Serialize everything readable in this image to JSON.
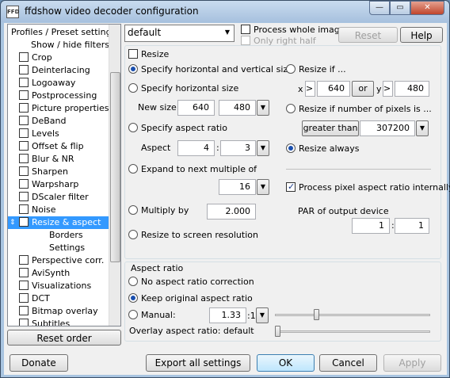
{
  "window": {
    "title": "ffdshow video decoder configuration",
    "icon_text": "FFD"
  },
  "titlebar_buttons": {
    "minimize": "—",
    "maximize": "▭",
    "close": "✕"
  },
  "tree": {
    "items": [
      {
        "label": "Profiles / Preset settings",
        "checkbox": false,
        "indent": 0
      },
      {
        "label": "Show / hide filters",
        "checkbox": false,
        "indent": 1
      },
      {
        "label": "Crop",
        "checkbox": true,
        "checked": false
      },
      {
        "label": "Deinterlacing",
        "checkbox": true,
        "checked": false
      },
      {
        "label": "Logoaway",
        "checkbox": true,
        "checked": false
      },
      {
        "label": "Postprocessing",
        "checkbox": true,
        "checked": false
      },
      {
        "label": "Picture properties",
        "checkbox": true,
        "checked": false
      },
      {
        "label": "DeBand",
        "checkbox": true,
        "checked": false
      },
      {
        "label": "Levels",
        "checkbox": true,
        "checked": false
      },
      {
        "label": "Offset & flip",
        "checkbox": true,
        "checked": false
      },
      {
        "label": "Blur & NR",
        "checkbox": true,
        "checked": false
      },
      {
        "label": "Sharpen",
        "checkbox": true,
        "checked": false
      },
      {
        "label": "Warpsharp",
        "checkbox": true,
        "checked": false
      },
      {
        "label": "DScaler filter",
        "checkbox": true,
        "checked": false
      },
      {
        "label": "Noise",
        "checkbox": true,
        "checked": false
      },
      {
        "label": "Resize & aspect",
        "checkbox": true,
        "checked": false,
        "selected": true
      },
      {
        "label": "Borders",
        "checkbox": false,
        "indent": 2
      },
      {
        "label": "Settings",
        "checkbox": false,
        "indent": 2
      },
      {
        "label": "Perspective corr.",
        "checkbox": true,
        "checked": false
      },
      {
        "label": "AviSynth",
        "checkbox": true,
        "checked": false
      },
      {
        "label": "Visualizations",
        "checkbox": true,
        "checked": false
      },
      {
        "label": "DCT",
        "checkbox": true,
        "checked": false
      },
      {
        "label": "Bitmap overlay",
        "checkbox": true,
        "checked": false
      },
      {
        "label": "Subtitles",
        "checkbox": true,
        "checked": false
      }
    ]
  },
  "buttons": {
    "reset_order": "Reset order",
    "reset": "Reset",
    "help": "Help",
    "donate": "Donate",
    "export_all": "Export all settings",
    "ok": "OK",
    "cancel": "Cancel",
    "apply": "Apply"
  },
  "profile": {
    "selected": "default"
  },
  "top_options": {
    "process_whole_image": "Process whole image",
    "only_right_half": "Only right half"
  },
  "resize": {
    "checkbox_label": "Resize",
    "specify_hv": "Specify horizontal and vertical size",
    "specify_h": "Specify horizontal size",
    "new_size_label": "New size",
    "new_w": "640",
    "new_h": "480",
    "specify_aspect": "Specify aspect ratio",
    "aspect_label": "Aspect",
    "aspect_a": "4",
    "aspect_b": "3",
    "expand_label": "Expand to next multiple of",
    "expand_value": "16",
    "multiply_label": "Multiply by",
    "multiply_value": "2.000",
    "screen_res": "Resize to screen resolution"
  },
  "resize_if": {
    "label": "Resize if ...",
    "x_label": "x",
    "x_op": ">",
    "x_value": "640",
    "or_label": "or",
    "y_label": "y",
    "y_op": ">",
    "y_value": "480",
    "pixels_label": "Resize if number of pixels is ...",
    "pixels_op": "greater than",
    "pixels_value": "307200",
    "always": "Resize always",
    "process_par": "Process pixel aspect ratio internally",
    "par_label": "PAR of output device",
    "par_a": "1",
    "par_b": "1"
  },
  "aspect_ratio": {
    "group_label": "Aspect ratio",
    "none": "No aspect ratio correction",
    "keep": "Keep original aspect ratio",
    "manual": "Manual:",
    "manual_value": "1.33",
    "manual_suffix": ":1",
    "overlay": "Overlay aspect ratio: default",
    "manual_slider_level": 0.26,
    "overlay_slider_level": 0.0
  }
}
